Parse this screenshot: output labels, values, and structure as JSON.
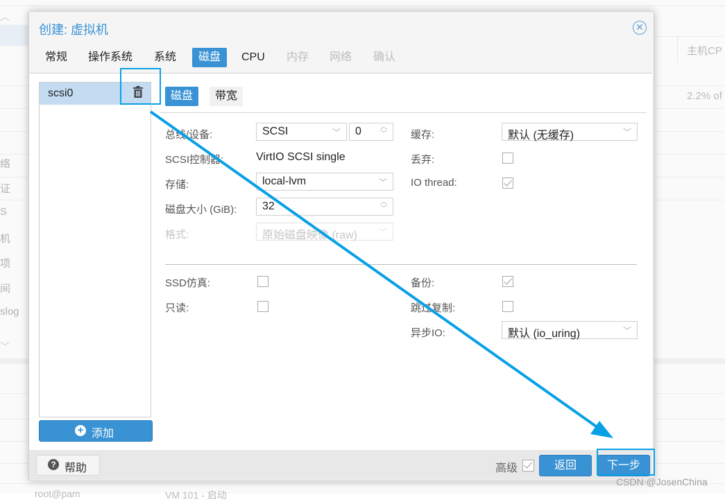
{
  "background": {
    "left_labels": [
      "络",
      "证",
      "S",
      "机",
      "项",
      "间",
      "slog"
    ],
    "right_header": "主机CP",
    "right_value": "2.2% of",
    "bottom_left": "root@pam",
    "bottom_mid": "VM 101 - 启动"
  },
  "dialog": {
    "title": "创建: 虚拟机",
    "close_icon": "close-circle-icon",
    "tabs": [
      {
        "label": "常规",
        "state": "normal"
      },
      {
        "label": "操作系统",
        "state": "normal"
      },
      {
        "label": "系统",
        "state": "normal"
      },
      {
        "label": "磁盘",
        "state": "active"
      },
      {
        "label": "CPU",
        "state": "normal"
      },
      {
        "label": "内存",
        "state": "disabled"
      },
      {
        "label": "网络",
        "state": "disabled"
      },
      {
        "label": "确认",
        "state": "disabled"
      }
    ],
    "disk_list": {
      "items": [
        {
          "name": "scsi0",
          "icon": "trash-icon"
        }
      ],
      "add_label": "添加"
    },
    "subtabs": [
      {
        "label": "磁盘",
        "state": "active"
      },
      {
        "label": "带宽",
        "state": "inactive"
      }
    ],
    "form": {
      "bus_device": {
        "label": "总线/设备:",
        "bus": "SCSI",
        "device": "0"
      },
      "scsi_controller": {
        "label": "SCSI控制器:",
        "value": "VirtIO SCSI single"
      },
      "storage": {
        "label": "存储:",
        "value": "local-lvm"
      },
      "disk_size": {
        "label": "磁盘大小 (GiB):",
        "value": "32"
      },
      "format": {
        "label": "格式:",
        "value": "原始磁盘映像 (raw)",
        "disabled": true
      },
      "cache": {
        "label": "缓存:",
        "value": "默认 (无缓存)"
      },
      "discard": {
        "label": "丢弃:",
        "checked": false
      },
      "io_thread": {
        "label": "IO thread:",
        "checked": true
      },
      "ssd_emulation": {
        "label": "SSD仿真:",
        "checked": false
      },
      "read_only": {
        "label": "只读:",
        "checked": false
      },
      "backup": {
        "label": "备份:",
        "checked": true
      },
      "skip_replication": {
        "label": "跳过复制:",
        "checked": false
      },
      "async_io": {
        "label": "异步IO:",
        "value": "默认 (io_uring)"
      }
    },
    "footer": {
      "help_label": "帮助",
      "advanced_label": "高级",
      "advanced_checked": true,
      "back_label": "返回",
      "next_label": "下一步"
    }
  },
  "annotation": {
    "color": "#0aa0e6"
  },
  "watermark": "CSDN @JosenChina"
}
